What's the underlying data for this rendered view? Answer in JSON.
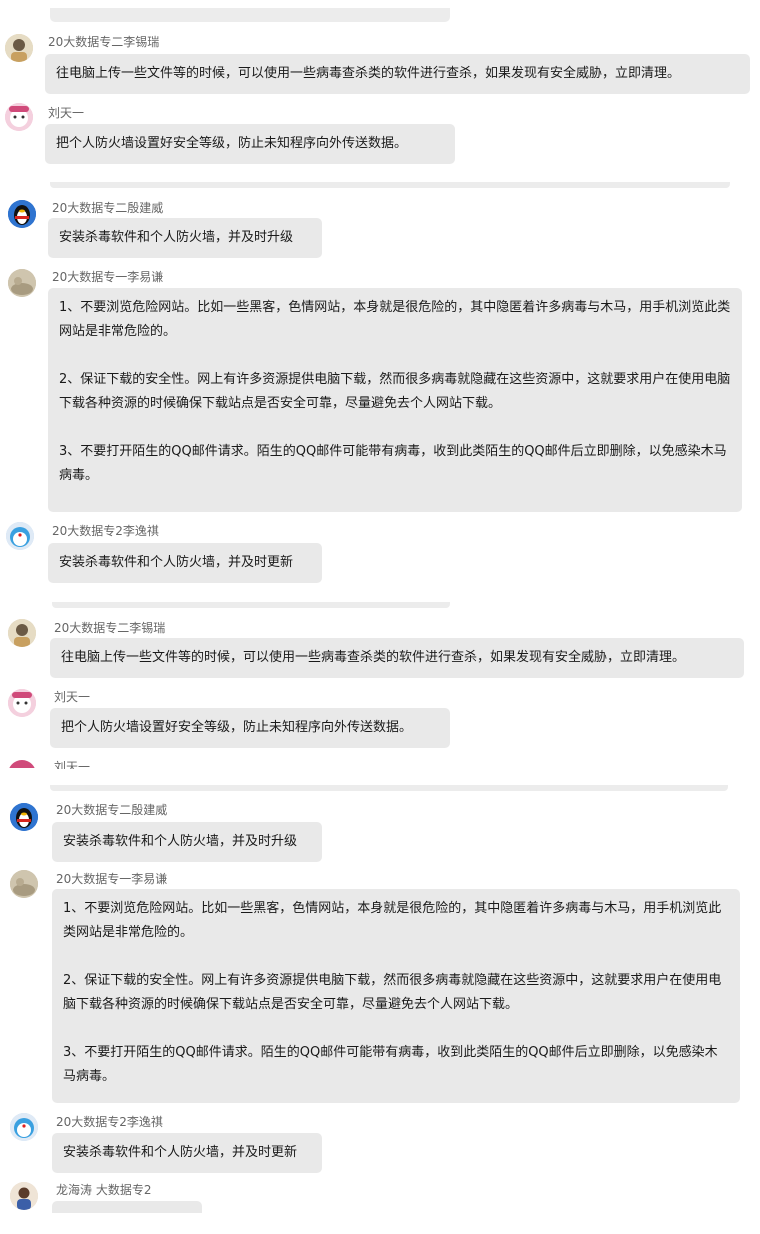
{
  "partial_name": "刘天一",
  "messages": [
    {
      "name": "20大数据专二李锡瑞",
      "text": [
        "往电脑上传一些文件等的时候，可以使用一些病毒查杀类的软件进行查杀，如果发现有安全威胁，立即清理。"
      ]
    },
    {
      "name": "刘天一",
      "text": [
        "把个人防火墙设置好安全等级，防止未知程序向外传送数据。"
      ]
    },
    {
      "name": "20大数据专二殷建威",
      "text": [
        "安装杀毒软件和个人防火墙，并及时升级"
      ]
    },
    {
      "name": "20大数据专一李易谦",
      "text": [
        "1、不要浏览危险网站。比如一些黑客，色情网站，本身就是很危险的，其中隐匿着许多病毒与木马，用手机浏览此类网站是非常危险的。",
        "2、保证下载的安全性。网上有许多资源提供电脑下载，然而很多病毒就隐藏在这些资源中，这就要求用户在使用电脑下载各种资源的时候确保下载站点是否安全可靠，尽量避免去个人网站下载。",
        "3、不要打开陌生的QQ邮件请求。陌生的QQ邮件可能带有病毒，收到此类陌生的QQ邮件后立即删除，以免感染木马病毒。"
      ]
    },
    {
      "name": "20大数据专2李逸祺",
      "text": [
        "安装杀毒软件和个人防火墙，并及时更新"
      ]
    },
    {
      "name": "20大数据专二李锡瑞",
      "text": [
        "往电脑上传一些文件等的时候，可以使用一些病毒查杀类的软件进行查杀，如果发现有安全威胁，立即清理。"
      ]
    },
    {
      "name": "刘天一",
      "text": [
        "把个人防火墙设置好安全等级，防止未知程序向外传送数据。"
      ]
    },
    {
      "name": "20大数据专二殷建威",
      "text": [
        "安装杀毒软件和个人防火墙，并及时升级"
      ]
    },
    {
      "name": "20大数据专一李易谦",
      "text": [
        "1、不要浏览危险网站。比如一些黑客，色情网站，本身就是很危险的，其中隐匿着许多病毒与木马，用手机浏览此类网站是非常危险的。",
        "2、保证下载的安全性。网上有许多资源提供电脑下载，然而很多病毒就隐藏在这些资源中，这就要求用户在使用电脑下载各种资源的时候确保下载站点是否安全可靠，尽量避免去个人网站下载。",
        "3、不要打开陌生的QQ邮件请求。陌生的QQ邮件可能带有病毒，收到此类陌生的QQ邮件后立即删除，以免感染木马病毒。"
      ]
    },
    {
      "name": "20大数据专2李逸祺",
      "text": [
        "安装杀毒软件和个人防火墙，并及时更新"
      ]
    },
    {
      "name": "龙海涛 大数据专2",
      "text": []
    }
  ]
}
